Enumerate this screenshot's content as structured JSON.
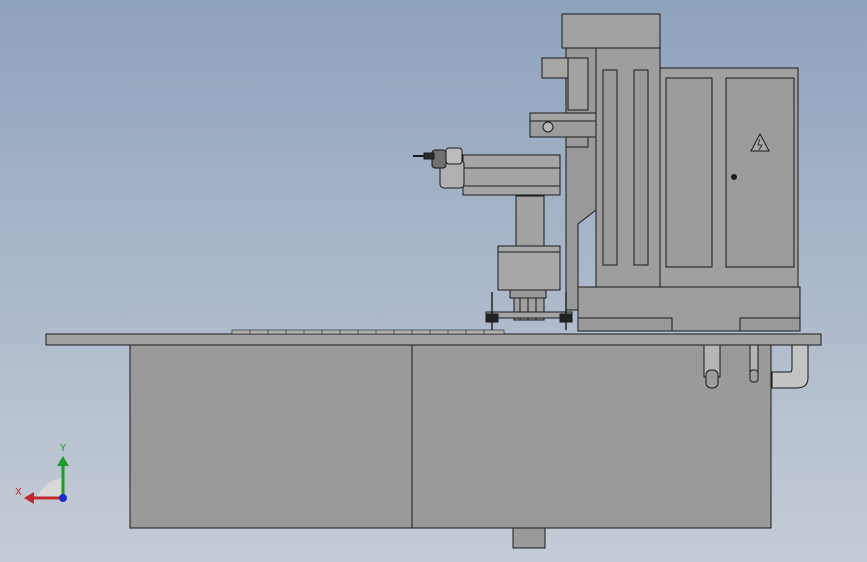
{
  "viewport": {
    "background_top": "#8ea3bc",
    "background_bottom": "#c5ccd6"
  },
  "model": {
    "components": [
      "base-table",
      "cabinet-left",
      "cabinet-right",
      "column",
      "spindle-head",
      "electrical-cabinet",
      "rotary-table",
      "pipe-fittings"
    ],
    "warning_icon": "high-voltage-warning-icon",
    "fill_color": "#9a9a9a",
    "line_color": "#1a1a1a"
  },
  "triad": {
    "x_label": "X",
    "y_label": "Y",
    "x_color": "#c0282d",
    "y_color": "#1f9a2b",
    "z_color": "#1b2ccf"
  }
}
